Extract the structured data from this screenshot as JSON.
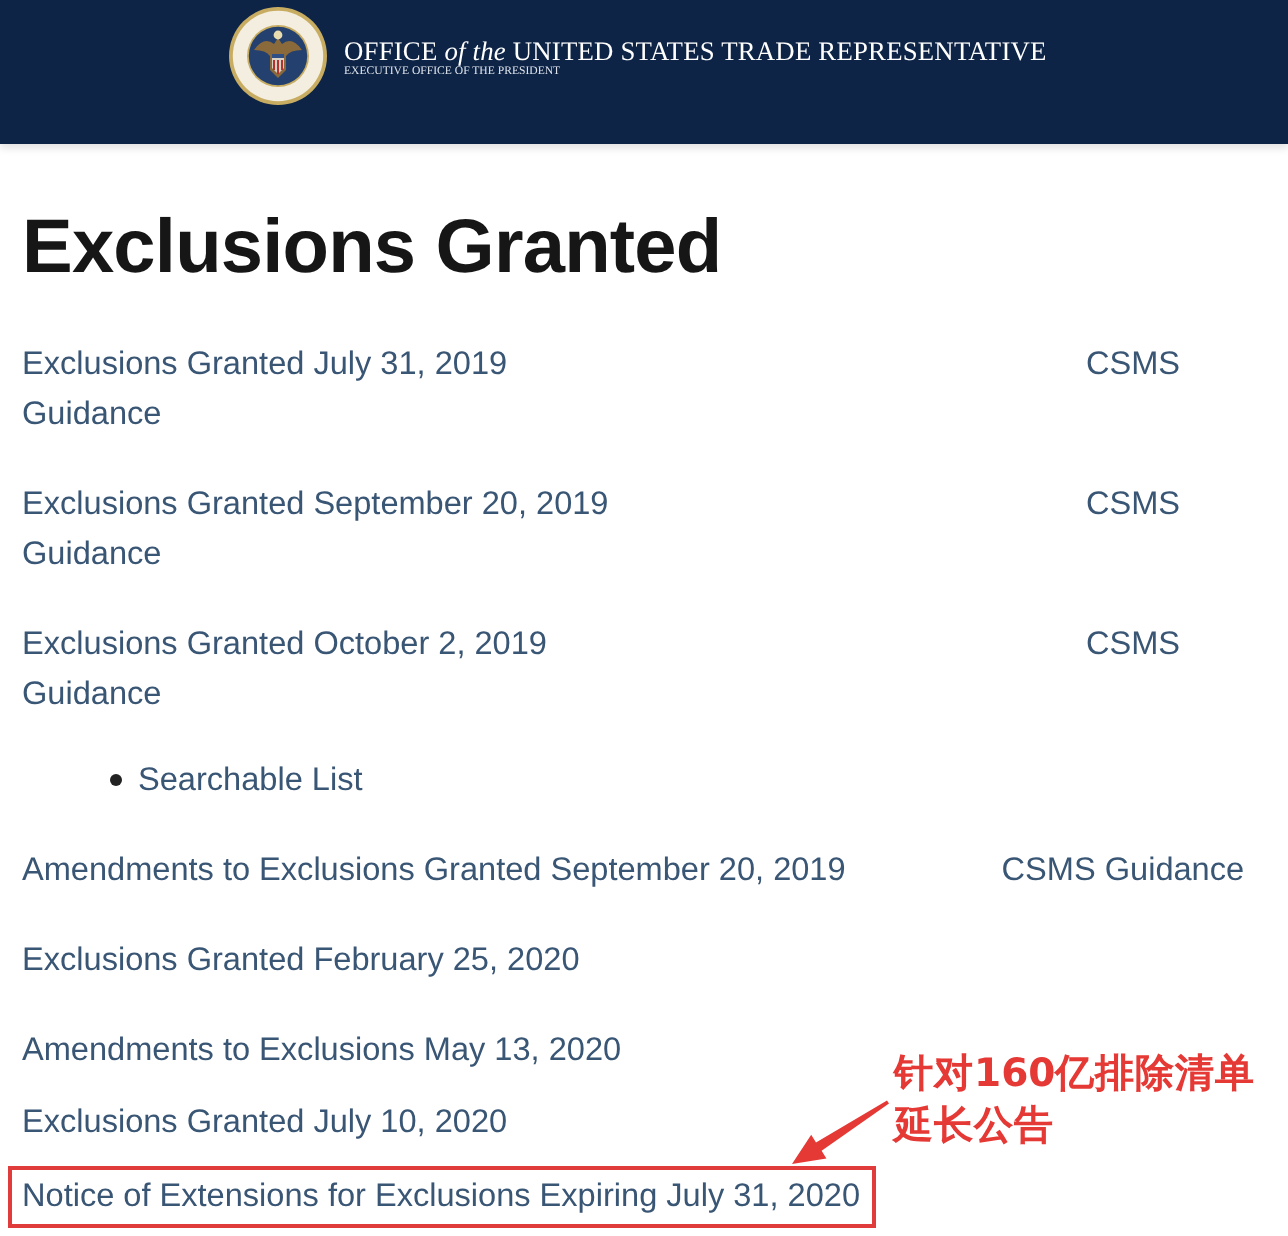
{
  "header": {
    "title": "OFFICE *of the* UNITED STATES TRADE REPRESENTATIVE",
    "subtitle": "EXECUTIVE OFFICE OF THE PRESIDENT"
  },
  "heading": "Exclusions Granted",
  "entries": [
    {
      "title": "Exclusions Granted July 31, 2019",
      "guidance": [
        "CSMS",
        "Guidance"
      ],
      "highlighted": false
    },
    {
      "title": "Exclusions Granted September 20, 2019",
      "guidance": [
        "CSMS",
        "Guidance"
      ],
      "highlighted": false
    },
    {
      "title": "Exclusions Granted October 2, 2019",
      "guidance": [
        "CSMS",
        "Guidance"
      ],
      "sub_links": [
        "Searchable List"
      ],
      "highlighted": false
    },
    {
      "title": "Amendments to Exclusions Granted September 20, 2019",
      "guidance": [
        "CSMS Guidance"
      ],
      "highlighted": false
    },
    {
      "title": "Exclusions Granted February 25, 2020",
      "highlighted": false
    },
    {
      "title": "Amendments to Exclusions May 13, 2020",
      "highlighted": false
    },
    {
      "title": "Exclusions Granted July 10, 2020",
      "highlighted": false
    },
    {
      "title": "Notice of Extensions for Exclusions Expiring July 31, 2020",
      "highlighted": true
    }
  ],
  "annotation": {
    "text": "针对160亿排除清单延长公告"
  }
}
